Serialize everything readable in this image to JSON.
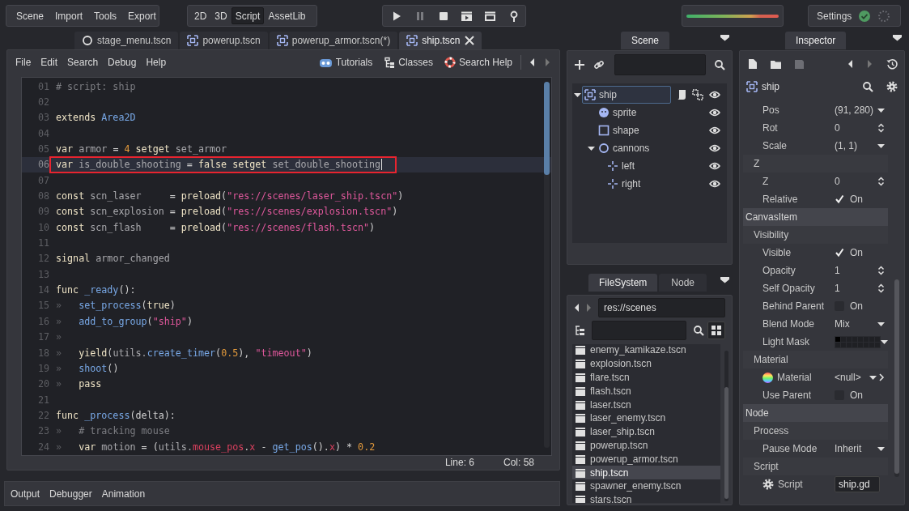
{
  "top_bar": {
    "menus": [
      "Scene",
      "Import",
      "Tools",
      "Export"
    ],
    "workspaces": [
      {
        "label": "2D",
        "selected": false
      },
      {
        "label": "3D",
        "selected": false
      },
      {
        "label": "Script",
        "selected": true
      },
      {
        "label": "AssetLib",
        "selected": false
      }
    ],
    "play_buttons": [
      {
        "kind": "play",
        "disabled": false
      },
      {
        "kind": "pause",
        "disabled": true
      },
      {
        "kind": "stop",
        "disabled": false
      },
      {
        "kind": "play_scene",
        "disabled": false
      },
      {
        "kind": "play_custom",
        "disabled": false
      },
      {
        "kind": "remote",
        "disabled": false
      }
    ],
    "meter": {
      "level": 1
    },
    "settings": "Settings"
  },
  "scene_tabs": [
    {
      "label": "stage_menu.tscn",
      "kind": "node",
      "selected": false
    },
    {
      "label": "powerup.tscn",
      "kind": "area",
      "selected": false
    },
    {
      "label": "powerup_armor.tscn(*)",
      "kind": "area",
      "selected": false
    },
    {
      "label": "ship.tscn",
      "kind": "area",
      "selected": true
    }
  ],
  "script_editor": {
    "menus": [
      "File",
      "Edit",
      "Search",
      "Debug",
      "Help"
    ],
    "help_buttons": [
      {
        "kind": "tutorials",
        "label": "Tutorials"
      },
      {
        "kind": "classes",
        "label": "Classes"
      },
      {
        "kind": "search_help",
        "label": "Search Help"
      }
    ],
    "lines": [
      {
        "number": "01",
        "current": false,
        "marked": false,
        "tokens": [
          {
            "kind": "comment",
            "text": "# script: ship"
          }
        ]
      },
      {
        "number": "02",
        "current": false,
        "marked": false
      },
      {
        "number": "03",
        "current": false,
        "marked": false,
        "tokens": [
          {
            "kind": "keyword",
            "text": "extends "
          },
          {
            "kind": "function",
            "text": "Area2D"
          }
        ]
      },
      {
        "number": "04",
        "current": false,
        "marked": false
      },
      {
        "number": "05",
        "current": false,
        "marked": false,
        "tokens": [
          {
            "kind": "keyword",
            "text": "var "
          },
          {
            "kind": "identifier",
            "text": "armor "
          },
          {
            "kind": "punctuation",
            "text": "= "
          },
          {
            "kind": "number",
            "text": "4"
          },
          {
            "kind": "keyword",
            "text": " setget "
          },
          {
            "kind": "identifier",
            "text": "set_armor"
          }
        ]
      },
      {
        "number": "06",
        "current": true,
        "marked": true,
        "tokens": [
          {
            "kind": "keyword",
            "text": "var "
          },
          {
            "kind": "identifier",
            "text": "is_double_shooting "
          },
          {
            "kind": "punctuation",
            "text": "= "
          },
          {
            "kind": "keyword",
            "text": "false setget "
          },
          {
            "kind": "identifier",
            "text": "set_double_shooting"
          }
        ]
      },
      {
        "number": "07",
        "current": false,
        "marked": false
      },
      {
        "number": "08",
        "current": false,
        "marked": false,
        "tokens": [
          {
            "kind": "keyword",
            "text": "const "
          },
          {
            "kind": "identifier",
            "text": "scn_laser     "
          },
          {
            "kind": "punctuation",
            "text": "= "
          },
          {
            "kind": "keyword",
            "text": "preload"
          },
          {
            "kind": "punctuation",
            "text": "("
          },
          {
            "kind": "string",
            "text": "\"res://scenes/laser_ship.tscn\""
          },
          {
            "kind": "punctuation",
            "text": ")"
          }
        ]
      },
      {
        "number": "09",
        "current": false,
        "marked": false,
        "tokens": [
          {
            "kind": "keyword",
            "text": "const "
          },
          {
            "kind": "identifier",
            "text": "scn_explosion "
          },
          {
            "kind": "punctuation",
            "text": "= "
          },
          {
            "kind": "keyword",
            "text": "preload"
          },
          {
            "kind": "punctuation",
            "text": "("
          },
          {
            "kind": "string",
            "text": "\"res://scenes/explosion.tscn\""
          },
          {
            "kind": "punctuation",
            "text": ")"
          }
        ]
      },
      {
        "number": "10",
        "current": false,
        "marked": false,
        "tokens": [
          {
            "kind": "keyword",
            "text": "const "
          },
          {
            "kind": "identifier",
            "text": "scn_flash     "
          },
          {
            "kind": "punctuation",
            "text": "= "
          },
          {
            "kind": "keyword",
            "text": "preload"
          },
          {
            "kind": "punctuation",
            "text": "("
          },
          {
            "kind": "string",
            "text": "\"res://scenes/flash.tscn\""
          },
          {
            "kind": "punctuation",
            "text": ")"
          }
        ]
      },
      {
        "number": "11",
        "current": false,
        "marked": false
      },
      {
        "number": "12",
        "current": false,
        "marked": false,
        "tokens": [
          {
            "kind": "keyword",
            "text": "signal "
          },
          {
            "kind": "identifier",
            "text": "armor_changed"
          }
        ]
      },
      {
        "number": "13",
        "current": false,
        "marked": false
      },
      {
        "number": "14",
        "current": false,
        "marked": false,
        "tokens": [
          {
            "kind": "keyword",
            "text": "func "
          },
          {
            "kind": "function",
            "text": "_ready"
          },
          {
            "kind": "punctuation",
            "text": "():"
          }
        ]
      },
      {
        "number": "15",
        "current": false,
        "marked": false,
        "tokens": [
          {
            "kind": "indent",
            "text": "»   "
          },
          {
            "kind": "function",
            "text": "set_process"
          },
          {
            "kind": "punctuation",
            "text": "("
          },
          {
            "kind": "keyword",
            "text": "true"
          },
          {
            "kind": "punctuation",
            "text": ")"
          }
        ]
      },
      {
        "number": "16",
        "current": false,
        "marked": false,
        "tokens": [
          {
            "kind": "indent",
            "text": "»   "
          },
          {
            "kind": "function",
            "text": "add_to_group"
          },
          {
            "kind": "punctuation",
            "text": "("
          },
          {
            "kind": "string",
            "text": "\"ship\""
          },
          {
            "kind": "punctuation",
            "text": ")"
          }
        ]
      },
      {
        "number": "17",
        "current": false,
        "marked": false,
        "tokens": [
          {
            "kind": "indent",
            "text": "»"
          }
        ]
      },
      {
        "number": "18",
        "current": false,
        "marked": false,
        "tokens": [
          {
            "kind": "indent",
            "text": "»   "
          },
          {
            "kind": "keyword",
            "text": "yield"
          },
          {
            "kind": "punctuation",
            "text": "("
          },
          {
            "kind": "identifier",
            "text": "utils."
          },
          {
            "kind": "function",
            "text": "create_timer"
          },
          {
            "kind": "punctuation",
            "text": "("
          },
          {
            "kind": "number",
            "text": "0.5"
          },
          {
            "kind": "punctuation",
            "text": "), "
          },
          {
            "kind": "string",
            "text": "\"timeout\""
          },
          {
            "kind": "punctuation",
            "text": ")"
          }
        ]
      },
      {
        "number": "19",
        "current": false,
        "marked": false,
        "tokens": [
          {
            "kind": "indent",
            "text": "»   "
          },
          {
            "kind": "function",
            "text": "shoot"
          },
          {
            "kind": "punctuation",
            "text": "()"
          }
        ]
      },
      {
        "number": "20",
        "current": false,
        "marked": false,
        "tokens": [
          {
            "kind": "indent",
            "text": "»   "
          },
          {
            "kind": "keyword",
            "text": "pass"
          }
        ]
      },
      {
        "number": "21",
        "current": false,
        "marked": false
      },
      {
        "number": "22",
        "current": false,
        "marked": false,
        "tokens": [
          {
            "kind": "keyword",
            "text": "func "
          },
          {
            "kind": "function",
            "text": "_process"
          },
          {
            "kind": "punctuation",
            "text": "(delta):"
          }
        ]
      },
      {
        "number": "23",
        "current": false,
        "marked": false,
        "tokens": [
          {
            "kind": "indent",
            "text": "»   "
          },
          {
            "kind": "comment",
            "text": "# tracking mouse"
          }
        ]
      },
      {
        "number": "24",
        "current": false,
        "marked": false,
        "tokens": [
          {
            "kind": "indent",
            "text": "»   "
          },
          {
            "kind": "keyword",
            "text": "var "
          },
          {
            "kind": "identifier",
            "text": "motion "
          },
          {
            "kind": "punctuation",
            "text": "= ("
          },
          {
            "kind": "identifier",
            "text": "utils."
          },
          {
            "kind": "member",
            "text": "mouse_pos"
          },
          {
            "kind": "punctuation",
            "text": "."
          },
          {
            "kind": "member",
            "text": "x"
          },
          {
            "kind": "punctuation",
            "text": " - "
          },
          {
            "kind": "function",
            "text": "get_pos"
          },
          {
            "kind": "punctuation",
            "text": "()."
          },
          {
            "kind": "member",
            "text": "x"
          },
          {
            "kind": "punctuation",
            "text": ") * "
          },
          {
            "kind": "number",
            "text": "0.2"
          }
        ]
      }
    ],
    "status": {
      "line": "Line: 6",
      "column": "Col: 58"
    }
  },
  "bottom_panel": {
    "tabs": [
      "Output",
      "Debugger",
      "Animation"
    ]
  },
  "scene_dock": {
    "tab": "Scene",
    "tree": [
      {
        "name": "ship",
        "kind": "area",
        "selected": true,
        "expanded": true,
        "children": [
          {
            "name": "sprite",
            "kind": "sprite",
            "selected": false
          },
          {
            "name": "shape",
            "kind": "shape",
            "selected": false
          },
          {
            "name": "cannons",
            "kind": "node2d",
            "selected": false,
            "expanded": true,
            "children": [
              {
                "name": "left",
                "kind": "position",
                "selected": false
              },
              {
                "name": "right",
                "kind": "position",
                "selected": false
              }
            ]
          }
        ]
      }
    ]
  },
  "filesystem_dock": {
    "tabs": [
      {
        "label": "FileSystem",
        "selected": true
      },
      {
        "label": "Node",
        "selected": false
      }
    ],
    "path": "res://scenes",
    "files": [
      {
        "name": "enemy_kamikaze.tscn",
        "selected": false
      },
      {
        "name": "explosion.tscn",
        "selected": false
      },
      {
        "name": "flare.tscn",
        "selected": false
      },
      {
        "name": "flash.tscn",
        "selected": false
      },
      {
        "name": "laser.tscn",
        "selected": false
      },
      {
        "name": "laser_enemy.tscn",
        "selected": false
      },
      {
        "name": "laser_ship.tscn",
        "selected": false
      },
      {
        "name": "powerup.tscn",
        "selected": false
      },
      {
        "name": "powerup_armor.tscn",
        "selected": false
      },
      {
        "name": "ship.tscn",
        "selected": true
      },
      {
        "name": "spawner_enemy.tscn",
        "selected": false
      },
      {
        "name": "stars.tscn",
        "selected": false
      }
    ]
  },
  "inspector": {
    "tab": "Inspector",
    "node": "ship",
    "properties": [
      {
        "kind": "dropdown",
        "label": "Pos",
        "value": "(91, 280)"
      },
      {
        "kind": "spin",
        "label": "Rot",
        "value": "0"
      },
      {
        "kind": "dropdown",
        "label": "Scale",
        "value": "(1, 1)"
      },
      {
        "kind": "group",
        "label": "Z"
      },
      {
        "kind": "spin",
        "label": "Z",
        "value": "0"
      },
      {
        "kind": "check",
        "label": "Relative",
        "checked": true,
        "value": "On"
      },
      {
        "kind": "section",
        "label": "CanvasItem"
      },
      {
        "kind": "group",
        "label": "Visibility"
      },
      {
        "kind": "check",
        "label": "Visible",
        "checked": true,
        "value": "On"
      },
      {
        "kind": "spin",
        "label": "Opacity",
        "value": "1"
      },
      {
        "kind": "spin",
        "label": "Self Opacity",
        "value": "1"
      },
      {
        "kind": "check",
        "label": "Behind Parent",
        "checked": false,
        "value": "On"
      },
      {
        "kind": "dropdown",
        "label": "Blend Mode",
        "value": "Mix"
      },
      {
        "kind": "mask",
        "label": "Light Mask"
      },
      {
        "kind": "group",
        "label": "Material"
      },
      {
        "kind": "resource",
        "label": "Material",
        "value": "<null>"
      },
      {
        "kind": "check",
        "label": "Use Parent",
        "checked": false,
        "value": "On"
      },
      {
        "kind": "section",
        "label": "Node"
      },
      {
        "kind": "group",
        "label": "Process"
      },
      {
        "kind": "dropdown",
        "label": "Pause Mode",
        "value": "Inherit"
      },
      {
        "kind": "group",
        "label": "Script"
      },
      {
        "kind": "script",
        "label": "Script",
        "value": "ship.gd"
      }
    ]
  }
}
